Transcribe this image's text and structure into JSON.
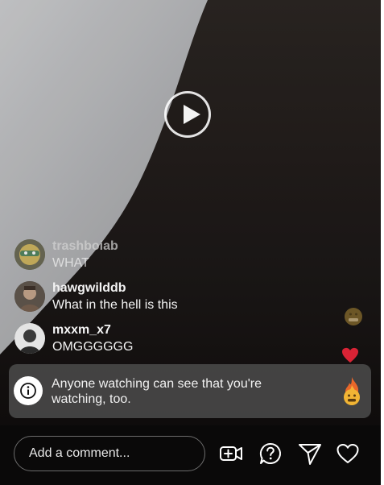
{
  "comments": [
    {
      "username": "trashboiab",
      "text": "WHAT"
    },
    {
      "username": "hawgwilddb",
      "text": "What in the hell is this"
    },
    {
      "username": "mxxm_x7",
      "text": "OMGGGGGG"
    }
  ],
  "notice": {
    "icon": "info-icon",
    "text": "Anyone watching can see that you're watching, too."
  },
  "bottom_bar": {
    "comment_placeholder": "Add a comment...",
    "icons": [
      "add-video-icon",
      "question-icon",
      "send-icon",
      "heart-icon"
    ]
  },
  "reactions": [
    "grimace-emoji",
    "red-heart",
    "fire-emoji"
  ],
  "colors": {
    "background": "#0c0a0a",
    "notice_bg": "#4a4a4a",
    "heart_red": "#d92335",
    "text": "#f3f3f3"
  }
}
